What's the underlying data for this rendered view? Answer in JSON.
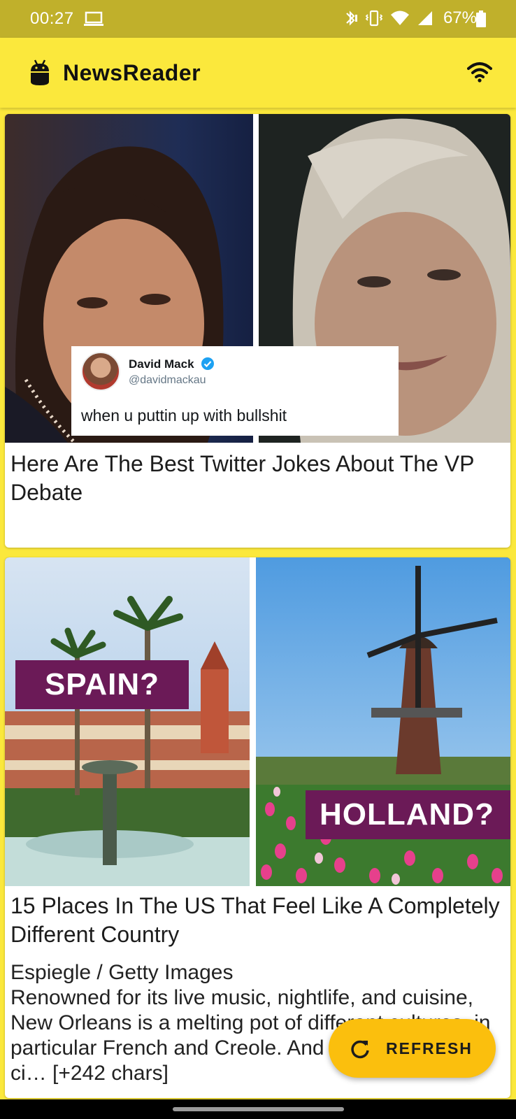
{
  "status_bar": {
    "time": "00:27",
    "battery_percent": "67%"
  },
  "app_bar": {
    "title": "NewsReader"
  },
  "articles": [
    {
      "title": "Here Are The Best Twitter Jokes About The VP Debate",
      "image": {
        "tweet_name": "David Mack",
        "tweet_handle": "@davidmackau",
        "tweet_text": "when u puttin up with bullshit"
      }
    },
    {
      "title": "15 Places In The US That Feel Like A Completely Different Country",
      "image": {
        "label_left": "SPAIN?",
        "label_right": "HOLLAND?"
      },
      "body": "Espiegle / Getty Images\nRenowned for its live music, nightlife, and cuisine, New Orleans is a melting pot of different cultures, in particular French and Creole. And nowhere in the ci… [+242 chars]"
    }
  ],
  "fab": {
    "label": "REFRESH"
  },
  "colors": {
    "app_bar": "#fbe83c",
    "status_bar": "#c0b02b",
    "fab": "#fbbf0d",
    "label_purple": "#6b1a57"
  }
}
